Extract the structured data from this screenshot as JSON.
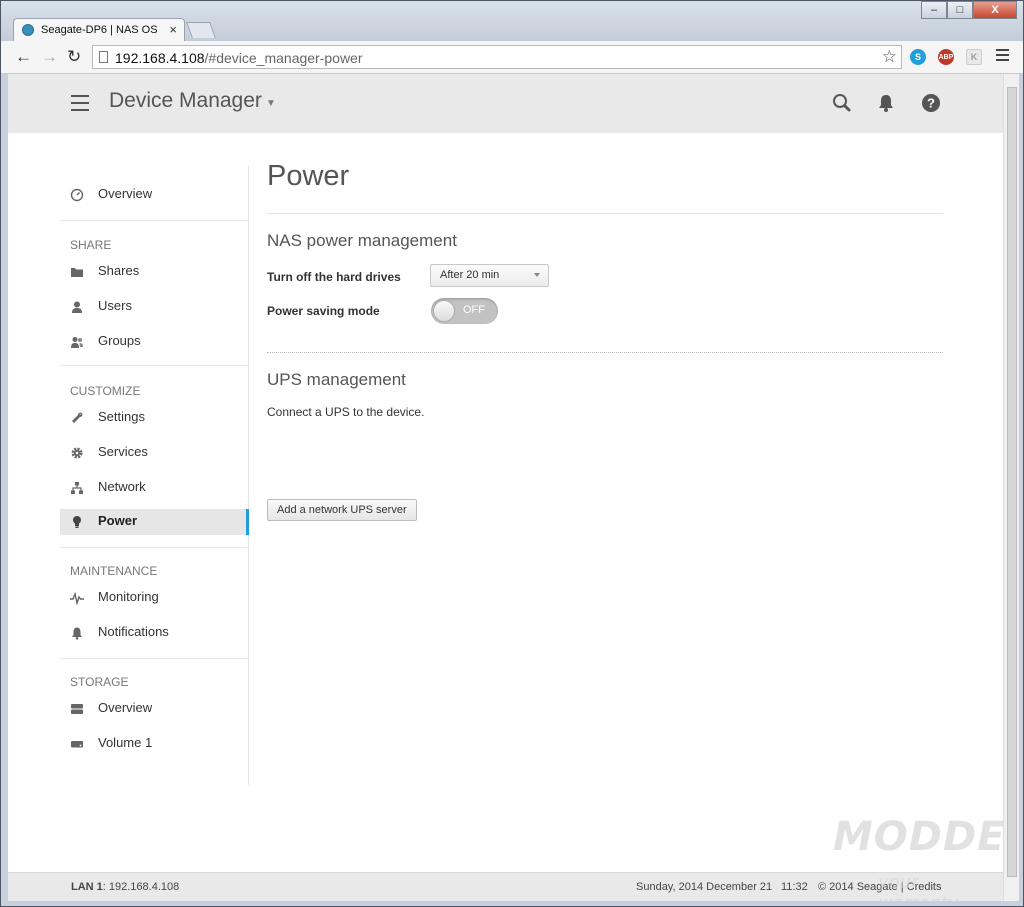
{
  "browser": {
    "tab_title": "Seagate-DP6 | NAS OS",
    "tab_close": "×",
    "url_host": "192.168.4.108",
    "url_path": "/#device_manager-power",
    "window_buttons": {
      "minimize": "–",
      "maximize": "□",
      "close": "X"
    },
    "extensions": [
      {
        "name": "skype",
        "label": "S",
        "color": "#1fa0dc"
      },
      {
        "name": "adblock-plus",
        "label": "ABP",
        "color": "#c0392b"
      },
      {
        "name": "k",
        "label": "K",
        "color": "#cfcfcf"
      }
    ]
  },
  "header": {
    "title": "Device Manager",
    "icons": [
      "search-icon",
      "bell-icon",
      "help-icon"
    ]
  },
  "sidebar": {
    "overview": "Overview",
    "sections": {
      "share": "SHARE",
      "customize": "CUSTOMIZE",
      "maintenance": "MAINTENANCE",
      "storage": "STORAGE"
    },
    "share_items": [
      "Shares",
      "Users",
      "Groups"
    ],
    "customize_items": [
      "Settings",
      "Services",
      "Network",
      "Power"
    ],
    "maintenance_items": [
      "Monitoring",
      "Notifications"
    ],
    "storage_items": [
      "Overview",
      "Volume 1"
    ],
    "active": "Power"
  },
  "main": {
    "title": "Power",
    "nas_power": {
      "heading": "NAS power management",
      "hdd_label": "Turn off the hard drives",
      "hdd_value": "After 20 min",
      "psm_label": "Power saving mode",
      "psm_state": "OFF"
    },
    "ups": {
      "heading": "UPS management",
      "description": "Connect a UPS to the device.",
      "button": "Add a network UPS server"
    }
  },
  "footer": {
    "lan_label": "LAN 1",
    "lan_value": ": 192.168.4.108",
    "date": "Sunday, 2014 December 21",
    "time": "11:32",
    "copyright": "© 2014 Seagate | Credits"
  },
  "watermark": {
    "line1": "MODDERS",
    "line2": "your warranty"
  }
}
